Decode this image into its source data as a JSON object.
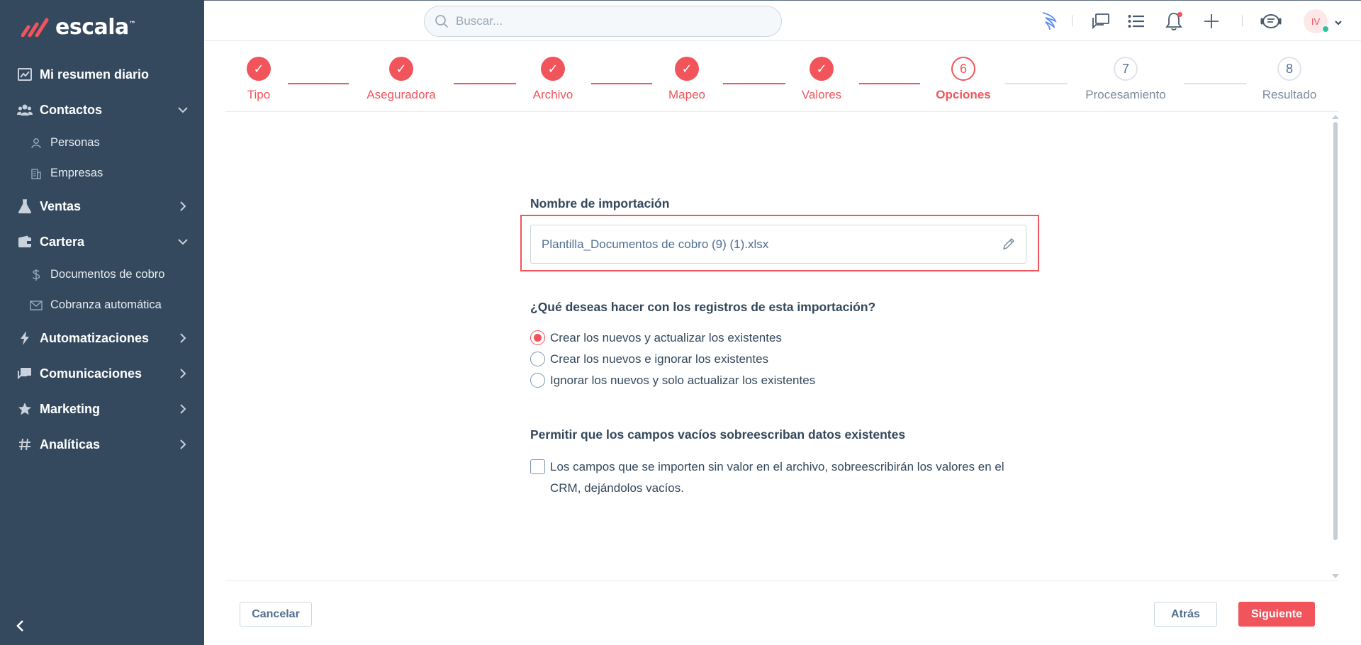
{
  "app": {
    "logo_text": "escala",
    "logo_tm": "™",
    "brand_color": "#f2545b",
    "sidebar_color": "#34495e"
  },
  "sidebar": {
    "items": [
      {
        "label": "Mi resumen diario",
        "icon": "chart-icon"
      },
      {
        "label": "Contactos",
        "icon": "users-icon",
        "expanded": true,
        "children": [
          {
            "label": "Personas",
            "icon": "person-icon"
          },
          {
            "label": "Empresas",
            "icon": "building-icon"
          }
        ]
      },
      {
        "label": "Ventas",
        "icon": "flask-icon",
        "expanded": false
      },
      {
        "label": "Cartera",
        "icon": "wallet-icon",
        "expanded": true,
        "children": [
          {
            "label": "Documentos de cobro",
            "icon": "dollar-icon"
          },
          {
            "label": "Cobranza automática",
            "icon": "envelope-icon"
          }
        ]
      },
      {
        "label": "Automatizaciones",
        "icon": "bolt-icon",
        "expanded": false
      },
      {
        "label": "Comunicaciones",
        "icon": "messages-icon",
        "expanded": false
      },
      {
        "label": "Marketing",
        "icon": "star-icon",
        "expanded": false
      },
      {
        "label": "Analíticas",
        "icon": "hash-icon",
        "expanded": false
      }
    ]
  },
  "topbar": {
    "search_placeholder": "Buscar...",
    "avatar_initials": "IV"
  },
  "stepper": {
    "steps": [
      {
        "number": "✓",
        "label": "Tipo",
        "state": "done"
      },
      {
        "number": "✓",
        "label": "Aseguradora",
        "state": "done"
      },
      {
        "number": "✓",
        "label": "Archivo",
        "state": "done"
      },
      {
        "number": "✓",
        "label": "Mapeo",
        "state": "done"
      },
      {
        "number": "✓",
        "label": "Valores",
        "state": "done"
      },
      {
        "number": "6",
        "label": "Opciones",
        "state": "active"
      },
      {
        "number": "7",
        "label": "Procesamiento",
        "state": "pending"
      },
      {
        "number": "8",
        "label": "Resultado",
        "state": "pending"
      }
    ]
  },
  "form": {
    "name_title": "Nombre de importación",
    "name_value": "Plantilla_Documentos de cobro (9) (1).xlsx",
    "records_title": "¿Qué deseas hacer con los registros de esta importación?",
    "records_options": [
      {
        "label": "Crear los nuevos y actualizar los existentes",
        "checked": true
      },
      {
        "label": "Crear los nuevos e ignorar los existentes",
        "checked": false
      },
      {
        "label": "Ignorar los nuevos y solo actualizar los existentes",
        "checked": false
      }
    ],
    "overwrite_title": "Permitir que los campos vacíos sobreescriban datos existentes",
    "overwrite_label": "Los campos que se importen sin valor en el archivo, sobreescribirán los valores en el CRM, dejándolos vacíos.",
    "overwrite_checked": false
  },
  "footer": {
    "cancel_label": "Cancelar",
    "back_label": "Atrás",
    "next_label": "Siguiente"
  }
}
